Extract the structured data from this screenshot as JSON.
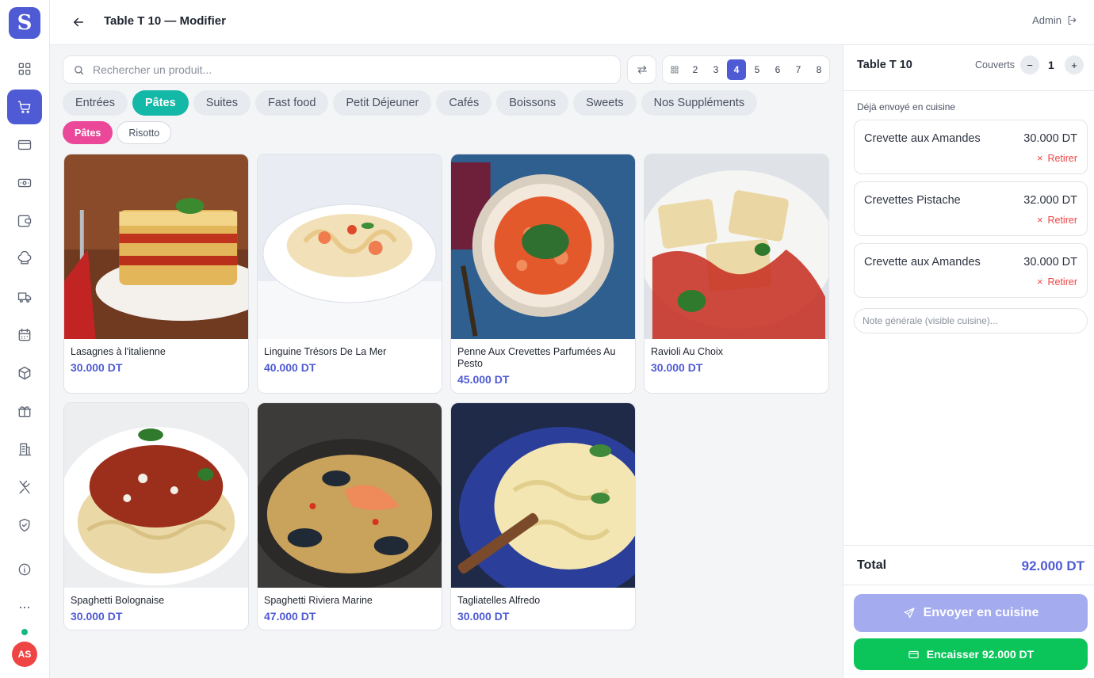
{
  "brand": {
    "logo_letter": "S"
  },
  "header": {
    "title": "Table T 10 — Modifier",
    "user_label": "Admin"
  },
  "sidebar": {
    "items": [
      {
        "icon": "dashboard-grid-icon"
      },
      {
        "icon": "cart-icon",
        "active": true
      },
      {
        "icon": "credit-card-icon"
      },
      {
        "icon": "banknote-icon"
      },
      {
        "icon": "wallet-icon"
      },
      {
        "icon": "chef-hat-icon"
      },
      {
        "icon": "truck-icon"
      },
      {
        "icon": "calendar-icon"
      },
      {
        "icon": "package-icon"
      },
      {
        "icon": "gift-icon"
      },
      {
        "icon": "building-icon"
      },
      {
        "icon": "utensils-icon"
      },
      {
        "icon": "shield-check-icon"
      },
      {
        "icon": "info-icon"
      },
      {
        "icon": "more-dots-icon"
      }
    ],
    "avatar_initials": "AS"
  },
  "search": {
    "placeholder": "Rechercher un produit..."
  },
  "pager": {
    "pages": [
      "2",
      "3",
      "4",
      "5",
      "6",
      "7",
      "8"
    ],
    "active": "4"
  },
  "categories": [
    {
      "label": "Entrées"
    },
    {
      "label": "Pâtes",
      "active": true
    },
    {
      "label": "Suites"
    },
    {
      "label": "Fast food"
    },
    {
      "label": "Petit Déjeuner"
    },
    {
      "label": "Cafés"
    },
    {
      "label": "Boissons"
    },
    {
      "label": "Sweets"
    },
    {
      "label": "Nos Suppléments"
    }
  ],
  "subcategories": [
    {
      "label": "Pâtes",
      "active": true
    },
    {
      "label": "Risotto"
    }
  ],
  "products": [
    {
      "name": "Lasagnes à l'italienne",
      "price": "30.000 DT"
    },
    {
      "name": "Linguine Trésors De La Mer",
      "price": "40.000 DT"
    },
    {
      "name": "Penne Aux Crevettes Parfumées Au Pesto",
      "price": "45.000 DT"
    },
    {
      "name": "Ravioli Au Choix",
      "price": "30.000 DT"
    },
    {
      "name": "Spaghetti Bolognaise",
      "price": "30.000 DT"
    },
    {
      "name": "Spaghetti Riviera Marine",
      "price": "47.000 DT"
    },
    {
      "name": "Tagliatelles Alfredo",
      "price": "30.000 DT"
    }
  ],
  "order": {
    "table_name": "Table T 10",
    "covers_label": "Couverts",
    "covers_minus": "−",
    "covers_plus": "+",
    "covers": "1",
    "sent_label": "Déjà envoyé en cuisine",
    "remove_label": "Retirer",
    "remove_icon": "×",
    "items": [
      {
        "name": "Crevette aux Amandes",
        "price": "30.000 DT"
      },
      {
        "name": "Crevettes Pistache",
        "price": "32.000 DT"
      },
      {
        "name": "Crevette aux Amandes",
        "price": "30.000 DT"
      }
    ],
    "note_placeholder": "Note générale (visible cuisine)...",
    "total_label": "Total",
    "total_value": "92.000 DT",
    "send_label": "Envoyer en cuisine",
    "pay_label": "Encaisser 92.000 DT"
  },
  "colors": {
    "accent": "#4f5bd5",
    "category_active": "#14b8a6",
    "subcategory_active": "#ec4899",
    "pay": "#0bc55b",
    "remove": "#ef4444"
  }
}
